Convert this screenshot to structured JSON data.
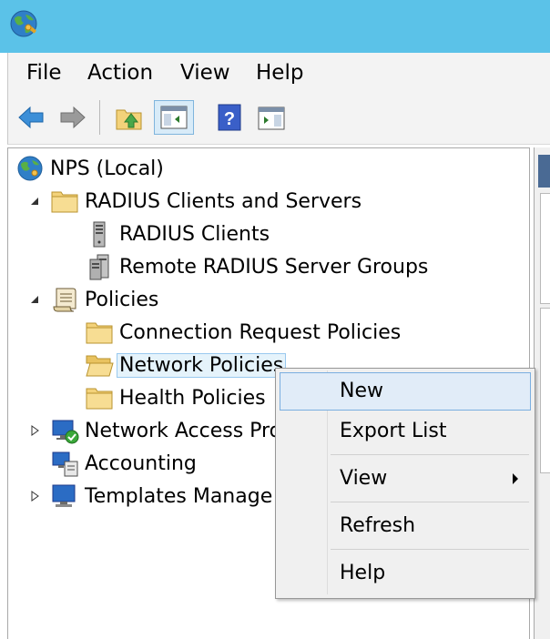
{
  "window": {
    "icon": "nps-globe-icon"
  },
  "menu": {
    "file": "File",
    "action": "Action",
    "view": "View",
    "help": "Help"
  },
  "toolbar": {
    "buttons": [
      "back-arrow-icon",
      "forward-arrow-icon",
      "up-folder-icon",
      "show-hide-console-tree-icon",
      "help-icon",
      "show-hide-action-pane-icon"
    ]
  },
  "tree": {
    "root": "NPS (Local)",
    "radius_clients_servers": "RADIUS Clients and Servers",
    "radius_clients": "RADIUS Clients",
    "remote_radius_groups": "Remote RADIUS Server Groups",
    "policies": "Policies",
    "connection_request_policies": "Connection Request Policies",
    "network_policies": "Network Policies",
    "health_policies": "Health Policies",
    "network_access_protection": "Network Access Pro",
    "accounting": "Accounting",
    "templates_management": "Templates Manage"
  },
  "context_menu": {
    "new": "New",
    "export_list": "Export List",
    "view": "View",
    "refresh": "Refresh",
    "help": "Help"
  },
  "colors": {
    "titlebar": "#5bc2e8",
    "hover_bg": "#e1ecf8",
    "hover_border": "#7aaee0",
    "folder": "#f3d27a"
  }
}
